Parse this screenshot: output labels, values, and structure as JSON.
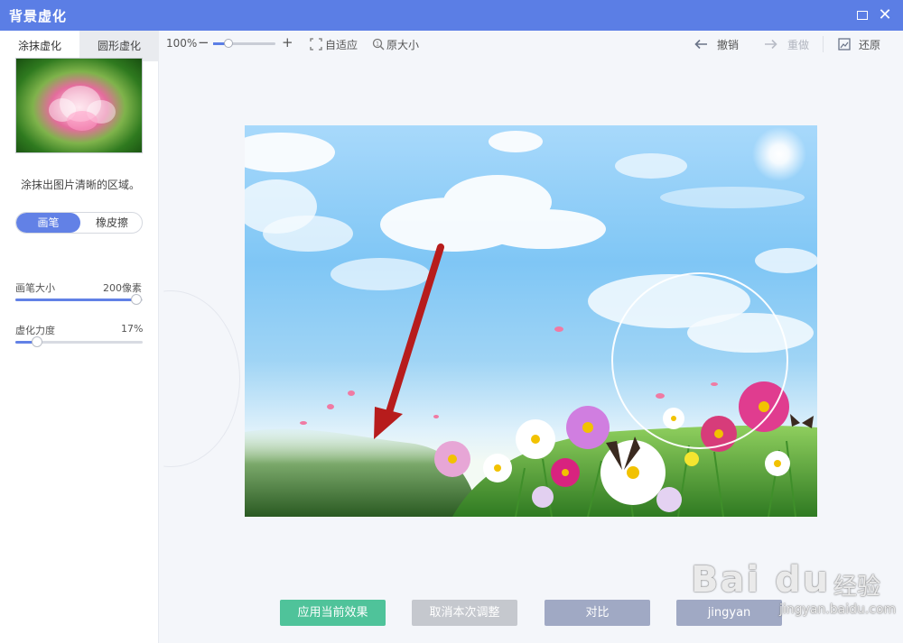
{
  "window": {
    "title": "背景虚化"
  },
  "tabs": [
    {
      "label": "涂抹虚化"
    },
    {
      "label": "圆形虚化"
    }
  ],
  "toolbar": {
    "zoom_level": "100%",
    "zoom_minus": "−",
    "zoom_plus": "+",
    "zoom_fraction": 0.25,
    "fit_label": "自适应",
    "original_size_label": "原大小",
    "undo_label": "撤销",
    "redo_label": "重做",
    "restore_label": "还原"
  },
  "sidebar": {
    "hint": "涂抹出图片清晰的区域。",
    "mode": {
      "brush": "画笔",
      "eraser": "橡皮擦",
      "selected": "画笔"
    },
    "brush_size": {
      "label": "画笔大小",
      "value": "200像素",
      "fraction": 0.95
    },
    "blur_strength": {
      "label": "虚化力度",
      "value": "17%",
      "fraction": 0.17
    }
  },
  "actions": {
    "apply": "应用当前效果",
    "cancel": "取消本次调整",
    "compare": "对比",
    "save": "jingyan"
  },
  "watermark": {
    "logo": "Bai du",
    "sub": "经验",
    "url": "jingyan.baidu.com"
  },
  "colors": {
    "titlebar": "#5b7ee5",
    "accent": "#6281e6",
    "apply": "#4fc39a",
    "arrow": "#b71c1c"
  }
}
